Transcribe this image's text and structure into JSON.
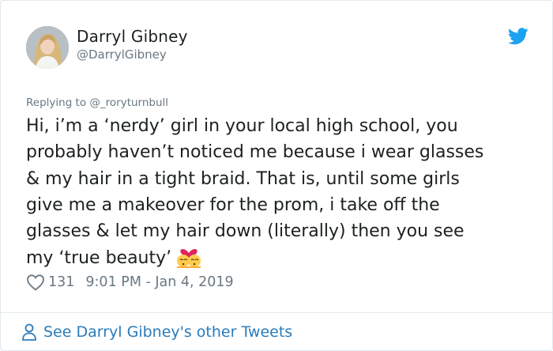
{
  "author": {
    "display_name": "Darryl Gibney",
    "handle": "@DarrylGibney",
    "avatar_icon": "profile-photo"
  },
  "tweet": {
    "reply_line": "Replying to @_roryturnbull",
    "lines": [
      "Hi, i’m a ‘nerdy’ girl in your local high school, you",
      "probably haven’t noticed me because i wear glasses",
      "& my hair in a tight braid. That is, until some girls",
      "give me a makeover for the prom, i take off the",
      "glasses & let my hair down (literally) then you see",
      "my ‘true beauty’"
    ],
    "emoji": "couple-with-heart-emoji"
  },
  "meta": {
    "like_count": "131",
    "timestamp": "9:01 PM - Jan 4, 2019"
  },
  "footer": {
    "link_text": "See Darryl Gibney's other Tweets"
  },
  "colors": {
    "brand_blue": "#1da1f2",
    "link_blue": "#2b7bb9",
    "text_primary": "#1c2022",
    "text_secondary": "#697882",
    "border": "#e1e8ed"
  }
}
